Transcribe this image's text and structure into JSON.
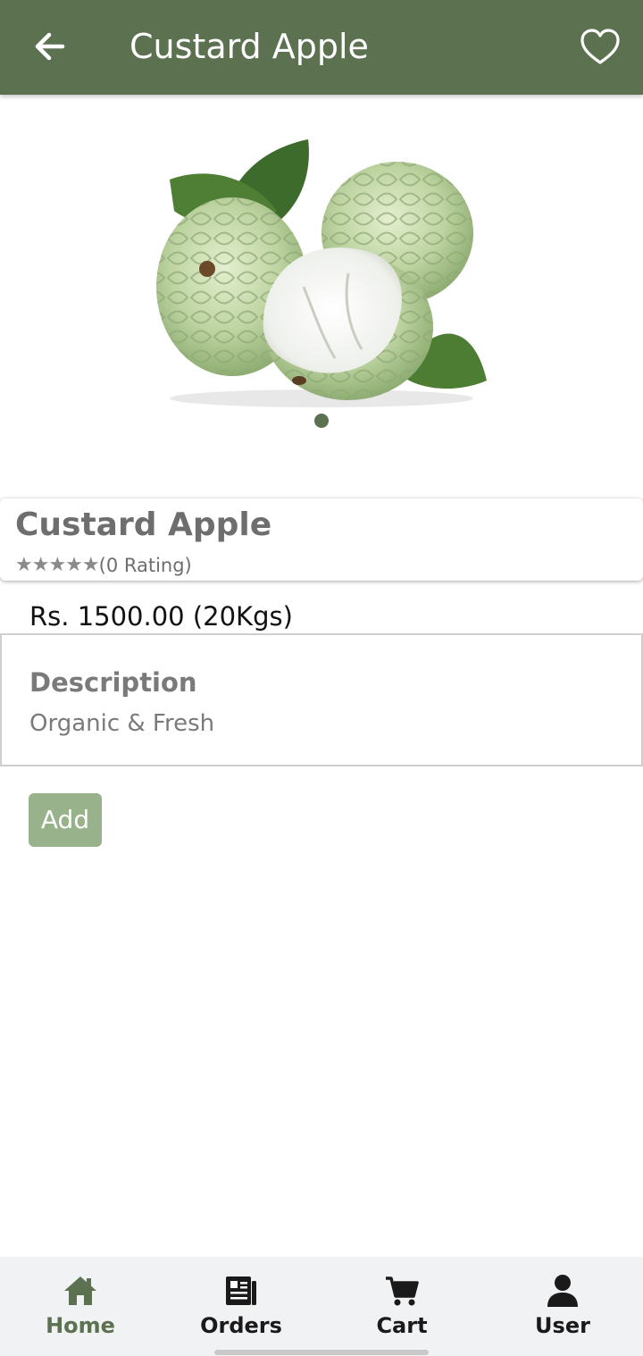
{
  "appbar": {
    "title": "Custard Apple",
    "back_icon": "arrow-left-icon",
    "favorite_icon": "heart-outline-icon",
    "color": "#5c7150"
  },
  "gallery": {
    "image_alt": "custard-apple-fruit",
    "page_count": 1,
    "current_page": 1
  },
  "product": {
    "name": "Custard Apple",
    "stars": "★★★★★",
    "rating_text": "(0 Rating)",
    "price": "Rs. 1500.00 (20Kgs)"
  },
  "description": {
    "title": "Description",
    "text": "Organic & Fresh"
  },
  "actions": {
    "add_label": "Add",
    "add_color": "#98b38c"
  },
  "bottom_nav": {
    "items": [
      {
        "label": "Home",
        "icon": "home-icon",
        "active": true
      },
      {
        "label": "Orders",
        "icon": "orders-icon",
        "active": false
      },
      {
        "label": "Cart",
        "icon": "cart-icon",
        "active": false
      },
      {
        "label": "User",
        "icon": "user-icon",
        "active": false
      }
    ],
    "active_color": "#5c7150"
  }
}
